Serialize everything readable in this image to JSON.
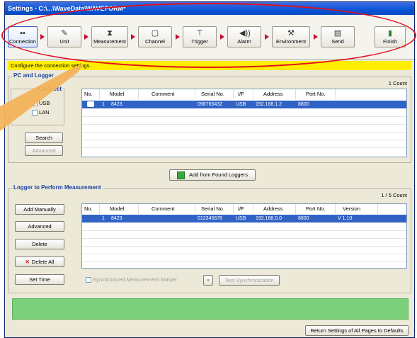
{
  "window": {
    "title": "Settings - C:\\...\\WaveData\\WAVEFORM*"
  },
  "toolbar": {
    "steps": [
      {
        "label": "Connection",
        "icon": "connection-icon",
        "glyph": "▪▪"
      },
      {
        "label": "Unit",
        "icon": "unit-icon",
        "glyph": "✎"
      },
      {
        "label": "Measurement",
        "icon": "hourglass-icon",
        "glyph": "⧗"
      },
      {
        "label": "Channel",
        "icon": "channel-icon",
        "glyph": "▢"
      },
      {
        "label": "Trigger",
        "icon": "trigger-icon",
        "glyph": "⊤"
      },
      {
        "label": "Alarm",
        "icon": "alarm-icon",
        "glyph": "◀))"
      },
      {
        "label": "Environment",
        "icon": "environment-icon",
        "glyph": "⚒"
      },
      {
        "label": "Send",
        "icon": "send-icon",
        "glyph": "▤"
      }
    ],
    "finish": {
      "label": "Finish",
      "icon": "finish-icon",
      "glyph": "▮"
    }
  },
  "instruction": "Configure the connection settings.",
  "pc_group": {
    "title": "PC and Logger",
    "connection_title": "Connect",
    "usb_label": "USB",
    "lan_label": "LAN",
    "search_label": "Search",
    "advanced_label": "Advanced",
    "count": "1 Count",
    "columns": [
      "No.",
      "Model",
      "Comment",
      "Serial No.",
      "I/F",
      "Address",
      "Port No."
    ],
    "rows": [
      {
        "no": "1",
        "model": "8423",
        "comment": "",
        "serial": "098765432",
        "iface": "USB",
        "address": "192.168.1.2",
        "port": "8800"
      }
    ]
  },
  "add_found_label": "Add from Found Loggers",
  "measure_group": {
    "title": "Logger to Perform Measurement",
    "count": "1 / 5 Count",
    "buttons": {
      "add_manually": "Add Manually",
      "advanced": "Advanced",
      "delete": "Delete",
      "delete_all": "Delete All",
      "set_time": "Set Time"
    },
    "columns": [
      "No.",
      "Model",
      "Comment",
      "Serial No.",
      "I/F",
      "Address",
      "Port No.",
      "Version"
    ],
    "rows": [
      {
        "no": "1",
        "model": "8423",
        "comment": "",
        "serial": "012345678",
        "iface": "USB",
        "address": "192.168.0.0",
        "port": "8800",
        "version": "V 1.10"
      }
    ],
    "sync_label": "Synchronized Measurement",
    "sync_value": "Master",
    "test_sync_label": "Test Synchronization"
  },
  "footer": {
    "return_label": "Return Settings of All Pages to Defaults"
  },
  "colors": {
    "highlight": "#e0101e",
    "selection": "#3163c5",
    "status_bar": "#7bd17b",
    "instruction_bar": "#ffee00"
  }
}
